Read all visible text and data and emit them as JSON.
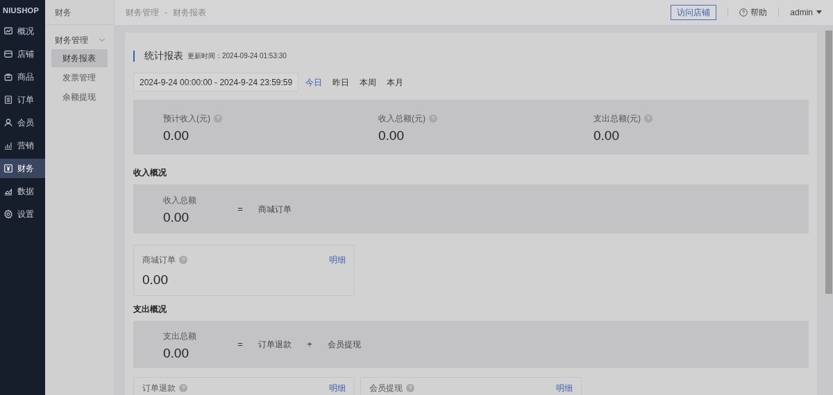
{
  "brand": "NIUSHOP",
  "nav": [
    {
      "label": "概况",
      "selected": false
    },
    {
      "label": "店铺",
      "selected": false
    },
    {
      "label": "商品",
      "selected": false
    },
    {
      "label": "订单",
      "selected": false
    },
    {
      "label": "会员",
      "selected": false
    },
    {
      "label": "营销",
      "selected": false
    },
    {
      "label": "财务",
      "selected": true
    },
    {
      "label": "数据",
      "selected": false
    },
    {
      "label": "设置",
      "selected": false
    }
  ],
  "submenu": {
    "title": "财务",
    "group": {
      "label": "财务管理",
      "expanded": true,
      "items": [
        {
          "label": "财务报表",
          "selected": true
        },
        {
          "label": "发票管理",
          "selected": false
        },
        {
          "label": "余额提现",
          "selected": false
        }
      ]
    }
  },
  "breadcrumb": {
    "items": [
      "财务管理",
      "财务报表"
    ],
    "separator": "-"
  },
  "topbar": {
    "visit_button": "访问店铺",
    "help": "帮助",
    "user": "admin"
  },
  "report": {
    "title": "统计报表",
    "updated": "更新时间：2024-09-24 01:53:30",
    "date_range": "2024-9-24 00:00:00 - 2024-9-24 23:59:59",
    "quick_ranges": [
      {
        "label": "今日",
        "selected": true
      },
      {
        "label": "昨日",
        "selected": false
      },
      {
        "label": "本周",
        "selected": false
      },
      {
        "label": "本月",
        "selected": false
      }
    ],
    "summary": [
      {
        "label": "预计收入(元)",
        "value": "0.00"
      },
      {
        "label": "收入总额(元)",
        "value": "0.00"
      },
      {
        "label": "支出总额(元)",
        "value": "0.00"
      }
    ]
  },
  "sections": [
    {
      "heading": "收入概况",
      "total": {
        "label": "收入总额",
        "value": "0.00"
      },
      "formula": [
        {
          "kind": "operator",
          "text": "="
        },
        {
          "kind": "term",
          "text": "商城订单"
        }
      ],
      "cards": [
        {
          "label": "商城订单",
          "value": "0.00",
          "link": "明细"
        }
      ]
    },
    {
      "heading": "支出概况",
      "total": {
        "label": "支出总额",
        "value": "0.00"
      },
      "formula": [
        {
          "kind": "operator",
          "text": "="
        },
        {
          "kind": "term",
          "text": "订单退款"
        },
        {
          "kind": "operator",
          "text": "+"
        },
        {
          "kind": "term",
          "text": "会员提现"
        }
      ],
      "cards": [
        {
          "label": "订单退款",
          "link": "明细"
        },
        {
          "label": "会员提现",
          "link": "明细"
        }
      ]
    }
  ]
}
